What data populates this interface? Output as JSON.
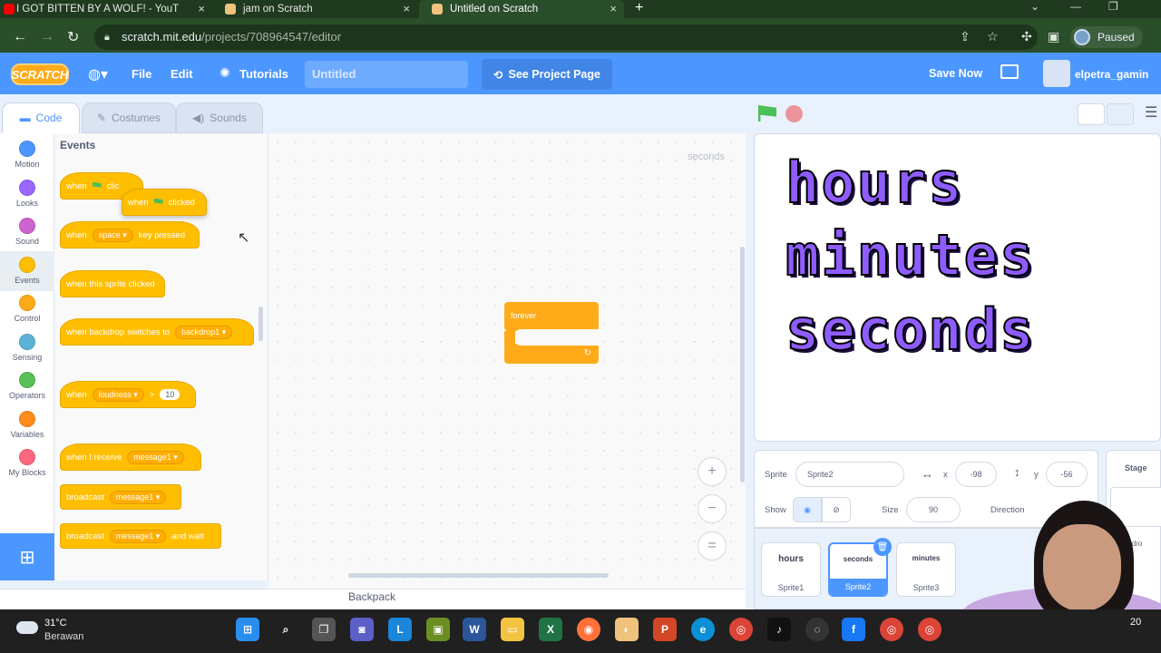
{
  "browser": {
    "tabs": [
      {
        "title": "I GOT BITTEN BY A WOLF! - YouT",
        "color": "#ff0000"
      },
      {
        "title": "jam on Scratch",
        "color": "#f0c27b"
      },
      {
        "title": "Untitled on Scratch",
        "color": "#f0c27b"
      }
    ],
    "url_host": "scratch.mit.edu",
    "url_path": "/projects/708964547/editor",
    "profile_status": "Paused"
  },
  "menu": {
    "logo": "SCRATCH",
    "file": "File",
    "edit": "Edit",
    "tutorials": "Tutorials",
    "project_title": "Untitled",
    "see_project_page": "See Project Page",
    "save_now": "Save Now",
    "username": "elpetra_gamin"
  },
  "editor_tabs": {
    "code": "Code",
    "costumes": "Costumes",
    "sounds": "Sounds"
  },
  "categories": [
    {
      "label": "Motion",
      "color": "#4c97ff"
    },
    {
      "label": "Looks",
      "color": "#9966ff"
    },
    {
      "label": "Sound",
      "color": "#cf63cf"
    },
    {
      "label": "Events",
      "color": "#ffbf00"
    },
    {
      "label": "Control",
      "color": "#ffab19"
    },
    {
      "label": "Sensing",
      "color": "#5cb1d6"
    },
    {
      "label": "Operators",
      "color": "#59c059"
    },
    {
      "label": "Variables",
      "color": "#ff8c1a"
    },
    {
      "label": "My Blocks",
      "color": "#ff6680"
    }
  ],
  "palette": {
    "title": "Events",
    "when": "when",
    "clicked": "clicked",
    "clicked_partial": "clic",
    "key_space": "space",
    "key_pressed": "key pressed",
    "sprite_clicked": "when this sprite clicked",
    "backdrop_switches": "when backdrop switches to",
    "backdrop_value": "backdrop1",
    "loudness": "loudness",
    "gt": ">",
    "loudness_value": "10",
    "when_receive": "when I receive",
    "message": "message1",
    "broadcast": "broadcast",
    "and_wait": "and wait"
  },
  "workspace": {
    "sprite_name": "seconds",
    "forever_label": "forever",
    "zoom_in": "+",
    "zoom_out": "−",
    "zoom_reset": "="
  },
  "backpack": "Backpack",
  "stage_text": {
    "line1": "hours",
    "line2": "minutes",
    "line3": "seconds"
  },
  "sprite_info": {
    "sprite_label": "Sprite",
    "sprite_name": "Sprite2",
    "x_label": "x",
    "x_value": "-98",
    "y_label": "y",
    "y_value": "-56",
    "show_label": "Show",
    "size_label": "Size",
    "size_value": "90",
    "direction_label": "Direction"
  },
  "sprites": [
    {
      "thumb": "hours",
      "name": "Sprite1"
    },
    {
      "thumb": "seconds",
      "name": "Sprite2"
    },
    {
      "thumb": "minutes",
      "name": "Sprite3"
    }
  ],
  "stage_panel": {
    "label": "Stage",
    "sub": "Backdro"
  },
  "taskbar": {
    "temperature": "31°C",
    "condition": "Berawan",
    "clock": "20"
  }
}
